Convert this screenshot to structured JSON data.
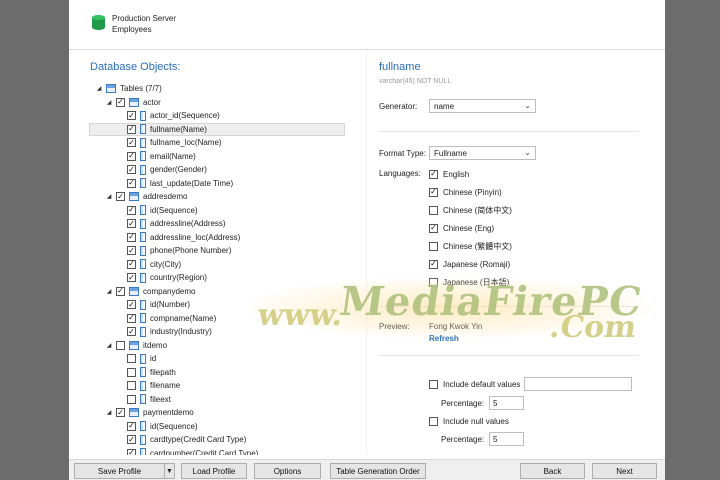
{
  "header": {
    "line1": "Production Server",
    "line2": "Employees"
  },
  "left": {
    "title": "Database Objects:",
    "tree": [
      {
        "level": 0,
        "kind": "root",
        "label": "Tables (7/7)",
        "expanded": true
      },
      {
        "level": 1,
        "kind": "table",
        "label": "actor",
        "checked": true,
        "expanded": true
      },
      {
        "level": 2,
        "kind": "column",
        "label": "actor_id(Sequence)",
        "checked": true
      },
      {
        "level": 2,
        "kind": "column",
        "label": "fullname(Name)",
        "checked": true,
        "selected": true
      },
      {
        "level": 2,
        "kind": "column",
        "label": "fullname_loc(Name)",
        "checked": true
      },
      {
        "level": 2,
        "kind": "column",
        "label": "email(Name)",
        "checked": true
      },
      {
        "level": 2,
        "kind": "column",
        "label": "gender(Gender)",
        "checked": true
      },
      {
        "level": 2,
        "kind": "column",
        "label": "last_update(Date Time)",
        "checked": true
      },
      {
        "level": 1,
        "kind": "table",
        "label": "addresdemo",
        "checked": true,
        "expanded": true
      },
      {
        "level": 2,
        "kind": "column",
        "label": "id(Sequence)",
        "checked": true
      },
      {
        "level": 2,
        "kind": "column",
        "label": "addressline(Address)",
        "checked": true
      },
      {
        "level": 2,
        "kind": "column",
        "label": "addressline_loc(Address)",
        "checked": true
      },
      {
        "level": 2,
        "kind": "column",
        "label": "phone(Phone Number)",
        "checked": true
      },
      {
        "level": 2,
        "kind": "column",
        "label": "city(City)",
        "checked": true
      },
      {
        "level": 2,
        "kind": "column",
        "label": "country(Region)",
        "checked": true
      },
      {
        "level": 1,
        "kind": "table",
        "label": "companydemo",
        "checked": true,
        "expanded": true
      },
      {
        "level": 2,
        "kind": "column",
        "label": "id(Number)",
        "checked": true
      },
      {
        "level": 2,
        "kind": "column",
        "label": "compname(Name)",
        "checked": true
      },
      {
        "level": 2,
        "kind": "column",
        "label": "industry(Industry)",
        "checked": true
      },
      {
        "level": 1,
        "kind": "table",
        "label": "itdemo",
        "checked": false,
        "expanded": true
      },
      {
        "level": 2,
        "kind": "column",
        "label": "id",
        "checked": false
      },
      {
        "level": 2,
        "kind": "column",
        "label": "filepath",
        "checked": false
      },
      {
        "level": 2,
        "kind": "column",
        "label": "filename",
        "checked": false
      },
      {
        "level": 2,
        "kind": "column",
        "label": "fileext",
        "checked": false
      },
      {
        "level": 1,
        "kind": "table",
        "label": "paymentdemo",
        "checked": true,
        "expanded": true
      },
      {
        "level": 2,
        "kind": "column",
        "label": "id(Sequence)",
        "checked": true
      },
      {
        "level": 2,
        "kind": "column",
        "label": "cardtype(Credit Card Type)",
        "checked": true
      },
      {
        "level": 2,
        "kind": "column",
        "label": "cardnumber(Credit Card Type)",
        "checked": true
      }
    ]
  },
  "right": {
    "title": "fullname",
    "subtitle": "varchar(45) NOT NULL",
    "generator_label": "Generator:",
    "generator_value": "name",
    "format_label": "Format Type:",
    "format_value": "Fullname",
    "languages_label": "Languages:",
    "languages": [
      {
        "label": "English",
        "checked": true
      },
      {
        "label": "Chinese (Pinyin)",
        "checked": true
      },
      {
        "label": "Chinese (简体中文)",
        "checked": false
      },
      {
        "label": "Chinese (Eng)",
        "checked": true
      },
      {
        "label": "Chinese (繁體中文)",
        "checked": false
      },
      {
        "label": "Japanese (Romaji)",
        "checked": true
      },
      {
        "label": "Japanese (日本語)",
        "checked": false
      }
    ],
    "preview_label": "Preview:",
    "preview_value": "Fong Kwok Yin",
    "refresh_label": "Refresh",
    "include_default_label": "Include default values",
    "include_default_checked": false,
    "include_default_value": "",
    "percentage_label": "Percentage:",
    "percentage_default": "5",
    "include_null_label": "Include null values",
    "include_null_checked": false,
    "percentage_null": "5"
  },
  "footer": {
    "save_profile": "Save Profile",
    "load_profile": "Load Profile",
    "options": "Options",
    "table_order": "Table Generation Order",
    "back": "Back",
    "next": "Next"
  },
  "watermark": {
    "www": "www.",
    "brand": "MediaFirePC",
    "com": ".Com"
  }
}
